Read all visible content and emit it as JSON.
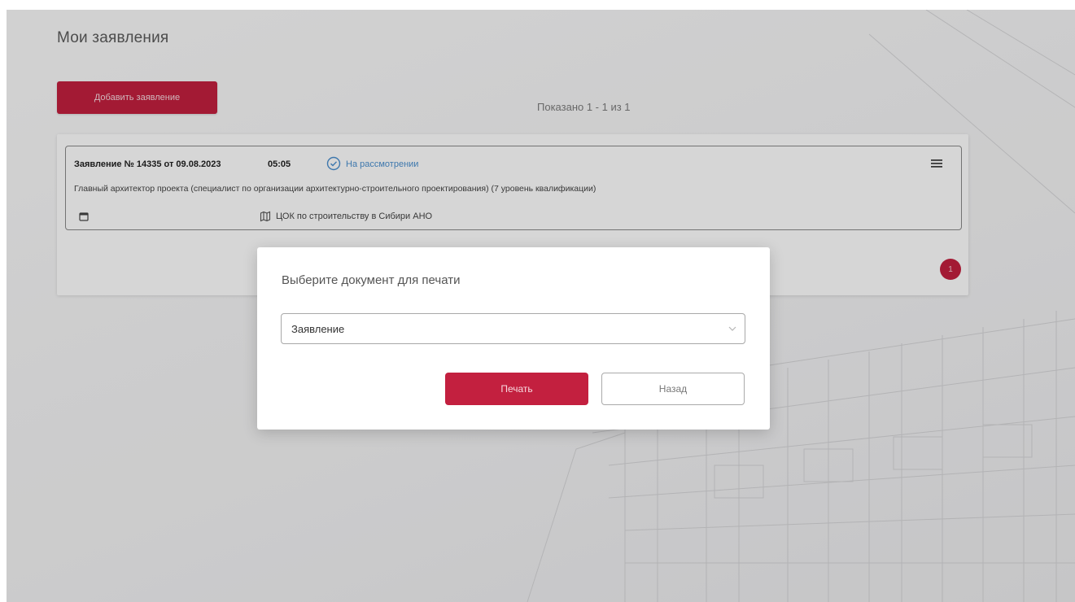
{
  "page": {
    "title": "Мои заявления",
    "add_button_label": "Добавить заявление",
    "shown_text": "Показано 1 - 1 из 1"
  },
  "application_card": {
    "title": "Заявление № 14335 от 09.08.2023",
    "time": "05:05",
    "status": "На рассмотрении",
    "description": "Главный архитектор проекта (специалист по организации архитектурно-строительного проектирования) (7 уровень квалификации)",
    "organization": "ЦОК по строительству в Сибири АНО",
    "icons": {
      "status": "check-circle-icon",
      "menu": "hamburger-icon",
      "date": "calendar-icon",
      "organization": "map-icon"
    }
  },
  "pagination": {
    "current_page": "1"
  },
  "modal": {
    "title": "Выберите документ для печати",
    "select_value": "Заявление",
    "print_label": "Печать",
    "back_label": "Назад"
  },
  "colors": {
    "accent": "#c3203f",
    "status": "#4a8fcf"
  }
}
